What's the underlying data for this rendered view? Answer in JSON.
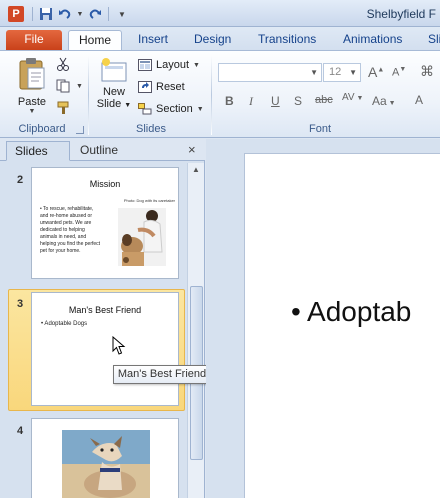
{
  "window": {
    "title": "Shelbyfield F",
    "app_icon": "P",
    "qat": [
      "save-icon",
      "undo-icon",
      "redo-icon",
      "customize-qat-icon"
    ]
  },
  "ribbon_tabs": {
    "file": "File",
    "home": "Home",
    "insert": "Insert",
    "design": "Design",
    "transitions": "Transitions",
    "animations": "Animations",
    "slideshow": "Sli"
  },
  "clipboard": {
    "paste": "Paste",
    "label": "Clipboard"
  },
  "slides_group": {
    "new_slide_line1": "New",
    "new_slide_line2": "Slide",
    "layout": "Layout",
    "reset": "Reset",
    "section": "Section",
    "label": "Slides"
  },
  "font_group": {
    "font_name": "",
    "font_size": "12",
    "label": "Font",
    "grow": "A",
    "shrink": "A",
    "bold": "B",
    "italic": "I",
    "underline": "U",
    "shadow": "S",
    "strike": "abc",
    "spacing": "AV",
    "case": "Aa",
    "color": "A"
  },
  "pane": {
    "tab_slides": "Slides",
    "tab_outline": "Outline",
    "close": "×"
  },
  "thumbnails": [
    {
      "number": "2",
      "title": "Mission",
      "bullets": "• To rescue, rehabilitate, and re-home abused or unwanted pets. We are dedicated to helping animals in need, and helping you find the perfect pet for your home.",
      "caption": "Photo: Dog with its caretaker"
    },
    {
      "number": "3",
      "title": "Man's Best Friend",
      "bullets": "• Adoptable Dogs"
    },
    {
      "number": "4"
    }
  ],
  "tooltip": "Man's Best Friend",
  "main_slide": {
    "bullet": "Adoptab"
  },
  "colors": {
    "file_tab": "#d24726",
    "selection": "#f9d77c",
    "ribbon_text": "#15428b"
  }
}
